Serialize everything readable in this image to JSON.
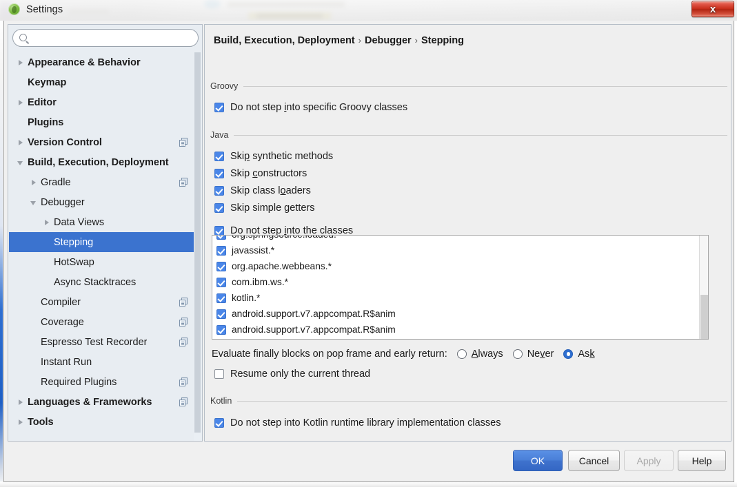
{
  "window": {
    "title": "Settings",
    "app_icon": "groovy-green-icon",
    "close_label": "x"
  },
  "sidebar": {
    "search": {
      "value": "",
      "placeholder": "",
      "icon": "search-icon"
    },
    "items": [
      {
        "label": "Appearance & Behavior",
        "arrow": "right",
        "bold": true,
        "indent": 0,
        "copy": false,
        "selected": false
      },
      {
        "label": "Keymap",
        "arrow": "none",
        "bold": true,
        "indent": 0,
        "copy": false,
        "selected": false
      },
      {
        "label": "Editor",
        "arrow": "right",
        "bold": true,
        "indent": 0,
        "copy": false,
        "selected": false
      },
      {
        "label": "Plugins",
        "arrow": "none",
        "bold": true,
        "indent": 0,
        "copy": false,
        "selected": false
      },
      {
        "label": "Version Control",
        "arrow": "right",
        "bold": true,
        "indent": 0,
        "copy": true,
        "selected": false
      },
      {
        "label": "Build, Execution, Deployment",
        "arrow": "down",
        "bold": true,
        "indent": 0,
        "copy": false,
        "selected": false
      },
      {
        "label": "Gradle",
        "arrow": "right",
        "bold": false,
        "indent": 1,
        "copy": true,
        "selected": false
      },
      {
        "label": "Debugger",
        "arrow": "down",
        "bold": false,
        "indent": 1,
        "copy": false,
        "selected": false
      },
      {
        "label": "Data Views",
        "arrow": "right",
        "bold": false,
        "indent": 2,
        "copy": false,
        "selected": false
      },
      {
        "label": "Stepping",
        "arrow": "none",
        "bold": false,
        "indent": 2,
        "copy": false,
        "selected": true
      },
      {
        "label": "HotSwap",
        "arrow": "none",
        "bold": false,
        "indent": 2,
        "copy": false,
        "selected": false
      },
      {
        "label": "Async Stacktraces",
        "arrow": "none",
        "bold": false,
        "indent": 2,
        "copy": false,
        "selected": false
      },
      {
        "label": "Compiler",
        "arrow": "none",
        "bold": false,
        "indent": 1,
        "copy": true,
        "selected": false
      },
      {
        "label": "Coverage",
        "arrow": "none",
        "bold": false,
        "indent": 1,
        "copy": true,
        "selected": false
      },
      {
        "label": "Espresso Test Recorder",
        "arrow": "none",
        "bold": false,
        "indent": 1,
        "copy": true,
        "selected": false
      },
      {
        "label": "Instant Run",
        "arrow": "none",
        "bold": false,
        "indent": 1,
        "copy": false,
        "selected": false
      },
      {
        "label": "Required Plugins",
        "arrow": "none",
        "bold": false,
        "indent": 1,
        "copy": true,
        "selected": false
      },
      {
        "label": "Languages & Frameworks",
        "arrow": "right",
        "bold": true,
        "indent": 0,
        "copy": true,
        "selected": false
      },
      {
        "label": "Tools",
        "arrow": "right",
        "bold": true,
        "indent": 0,
        "copy": false,
        "selected": false
      }
    ]
  },
  "breadcrumb": {
    "parts": [
      "Build, Execution, Deployment",
      "Debugger",
      "Stepping"
    ],
    "separator": "›"
  },
  "groovy": {
    "group_label": "Groovy",
    "checkbox": {
      "before": "Do not step ",
      "mnemonic": "i",
      "after": "nto specific Groovy classes",
      "checked": true
    }
  },
  "java": {
    "group_label": "Java",
    "options": [
      {
        "before": "Ski",
        "mnemonic": "p",
        "after": " synthetic methods",
        "checked": true
      },
      {
        "before": "Skip ",
        "mnemonic": "c",
        "after": "onstructors",
        "checked": true
      },
      {
        "before": "Skip class l",
        "mnemonic": "o",
        "after": "aders",
        "checked": true
      },
      {
        "before": "Skip simple ",
        "mnemonic": "g",
        "after": "etters",
        "checked": true
      },
      {
        "before": "Do not step ",
        "mnemonic": "i",
        "after": "nto the classes",
        "checked": true
      }
    ],
    "class_list": [
      {
        "label": "org.springsource.loaded.",
        "checked": true
      },
      {
        "label": "javassist.*",
        "checked": true
      },
      {
        "label": "org.apache.webbeans.*",
        "checked": true
      },
      {
        "label": "com.ibm.ws.*",
        "checked": true
      },
      {
        "label": "kotlin.*",
        "checked": true
      },
      {
        "label": "android.support.v7.appcompat.R$anim",
        "checked": true
      },
      {
        "label": "android.support.v7.appcompat.R$anim",
        "checked": true
      }
    ],
    "list_buttons": [
      {
        "name": "add-class-button",
        "icon": "plus-class-icon",
        "glyph": "c"
      },
      {
        "name": "add-pattern-button",
        "icon": "plus-pattern-icon",
        "glyph": "?"
      },
      {
        "name": "remove-button",
        "icon": "minus-icon",
        "glyph": ""
      }
    ],
    "evaluate_label": "Evaluate finally blocks on pop frame and early return:",
    "radios": [
      {
        "before": "",
        "mnemonic": "A",
        "after": "lways",
        "selected": false
      },
      {
        "before": "Ne",
        "mnemonic": "v",
        "after": "er",
        "selected": false
      },
      {
        "before": "As",
        "mnemonic": "k",
        "after": "",
        "selected": true
      }
    ],
    "resume_checkbox": {
      "label": "Resume only the current thread",
      "checked": false
    }
  },
  "kotlin": {
    "group_label": "Kotlin",
    "checkbox": {
      "label": "Do not step into Kotlin runtime library implementation classes",
      "checked": true
    }
  },
  "footer": {
    "ok": "OK",
    "cancel": "Cancel",
    "apply": "Apply",
    "help": "Help",
    "apply_disabled": true
  },
  "colors": {
    "accent_blue": "#3b73cf",
    "checkbox_blue": "#4a86e8",
    "close_red": "#c62c19",
    "sidebar_bg": "#e8edf2",
    "panel_bg": "#efefef"
  }
}
